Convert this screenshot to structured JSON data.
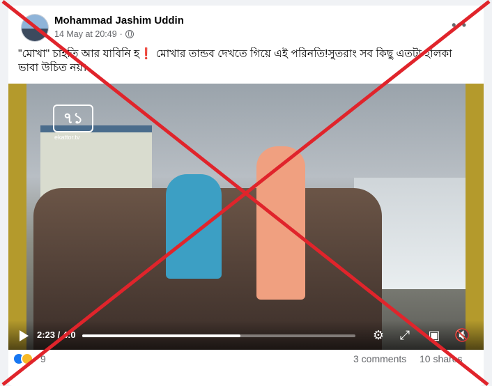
{
  "post": {
    "author": "Mohammad Jashim Uddin",
    "timestamp": "14 May at 20:49",
    "separator": "·",
    "more": "•••",
    "caption_line1": "\"মোখা\" চাইতি আর যাবিনি হ❗ মোখার তান্ডব দেখতে গিয়ে এই পরিনতি!সুতরাং সব কিছু এতটা হালকা",
    "caption_line2": "ভাবা উচিত নয়।"
  },
  "video": {
    "channel_logo": "৭১",
    "channel_site": "ekattor.tv",
    "time": "2:23 / 4:0",
    "progress": 0.58,
    "icons": [
      "play-icon",
      "settings-icon",
      "fullscreen-icon",
      "pip-icon",
      "mute-icon"
    ]
  },
  "footer": {
    "reaction_count": "9",
    "comments": "3 comments",
    "shares": "10 shares"
  },
  "overlay": {
    "cross_color": "#e0242b"
  }
}
